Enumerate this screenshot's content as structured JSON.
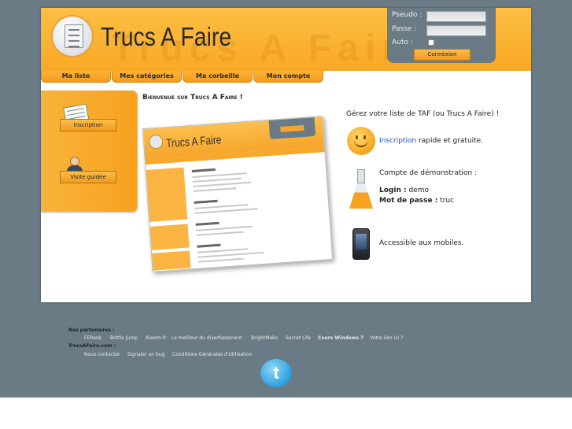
{
  "logo": {
    "text": "Trucs A Faire",
    "watermark": "Trucs A Faire"
  },
  "login": {
    "pseudo_label": "Pseudo :",
    "passe_label": "Passe :",
    "auto_label": "Auto :",
    "button": "Connexion"
  },
  "nav": {
    "tabs": [
      "Ma liste",
      "Mes catégories",
      "Ma corbeille",
      "Mon compte"
    ]
  },
  "sidebar": {
    "inscription": "Inscription",
    "visite": "Visite guidée"
  },
  "main": {
    "welcome": "Bienvenue sur Trucs A Faire !",
    "preview_title": "Trucs A Faire",
    "tagline": "Gérez votre liste de TAF (ou Trucs A Faire) !",
    "feature1_link": "Inscription",
    "feature1_rest": " rapide et gratuite.",
    "demo_title": "Compte de démonstration :",
    "login_label": "Login :",
    "login_value": " demo",
    "password_label": "Mot de passe :",
    "password_value": " truc",
    "mobile": "Accessible aux mobiles."
  },
  "footer": {
    "partners_label": "Nos partenaires :",
    "partners": [
      "FERank",
      "Bottle Jump",
      "Kiwom.fr",
      "Le meilleur du divertissement",
      "BrightMeko",
      "Secret Life",
      "Cours Windows 7",
      "Votre lien ici ?"
    ],
    "site_label": "TrucsAFaire.com :",
    "site_links": [
      "Nous contacter",
      "Signaler un bug",
      "Conditions Générales d'Utilisation"
    ]
  },
  "colors": {
    "accent": "#f7a21f",
    "background": "#6b7b86",
    "link": "#1a56b0"
  }
}
